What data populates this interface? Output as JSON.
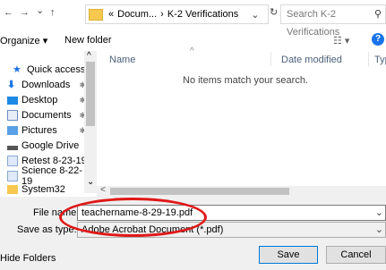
{
  "address_bar": {
    "back_glyph": "←",
    "forward_glyph": "→",
    "recent_glyph": "⌄",
    "up_glyph": "↑",
    "overflow": "«",
    "crumb_1": "Docum...",
    "separator": "›",
    "crumb_2": "K-2 Verifications",
    "dropdown_glyph": "⌄",
    "refresh_glyph": "↻",
    "search_placeholder": "Search K-2 Verifications",
    "search_glyph": "⚲"
  },
  "toolbar": {
    "organize": "Organize ▾",
    "new_folder": "New folder",
    "view_glyph": "☷ ▾",
    "help_glyph": "?"
  },
  "nav": {
    "items": [
      {
        "label": "Quick access",
        "icon": "star-icon",
        "pinned": false
      },
      {
        "label": "Downloads",
        "icon": "download-icon",
        "pinned": true
      },
      {
        "label": "Desktop",
        "icon": "desktop-icon",
        "pinned": true
      },
      {
        "label": "Documents",
        "icon": "documents-icon",
        "pinned": true
      },
      {
        "label": "Pictures",
        "icon": "pictures-icon",
        "pinned": true
      },
      {
        "label": "Google Drive",
        "icon": "drive-icon",
        "pinned": true
      },
      {
        "label": "Retest 8-23-19",
        "icon": "file-icon",
        "pinned": false
      },
      {
        "label": "Science 8-22-19",
        "icon": "file-icon",
        "pinned": false
      },
      {
        "label": "System32",
        "icon": "folder-icon",
        "pinned": false
      }
    ],
    "pin_glyph": "✱",
    "scroll_up": "^",
    "scroll_down": "⌄"
  },
  "list": {
    "col_name": "Name",
    "col_date": "Date modified",
    "col_type": "Typ",
    "sort_glyph": "^",
    "empty_message": "No items match your search.",
    "hscroll_left": "<"
  },
  "form": {
    "filename_label": "File name:",
    "filename_value": "teachername-8-29-19.pdf",
    "savetype_label": "Save as type:",
    "savetype_value": "Adobe Acrobat Document (*.pdf)",
    "hide_folders": "Hide Folders",
    "save": "Save",
    "cancel": "Cancel"
  },
  "colors": {
    "annotation": "#e01818",
    "help_blue": "#1a73e8",
    "folder_yellow": "#f6c94e"
  }
}
